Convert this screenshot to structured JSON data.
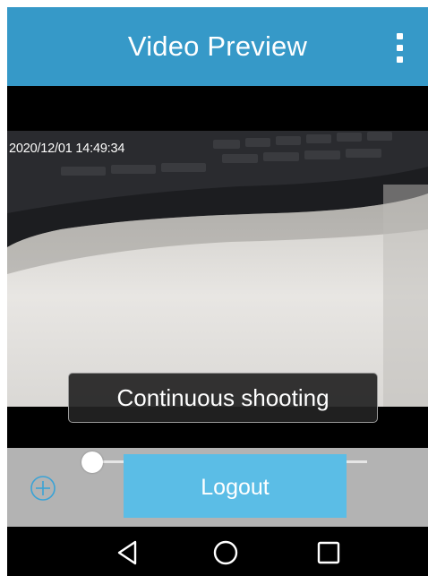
{
  "header": {
    "title": "Video Preview",
    "menu_icon": "more-vertical-icon"
  },
  "video": {
    "timestamp": "2020/12/01 14:49:34",
    "toast": "Continuous shooting"
  },
  "controls": {
    "zoom_icon": "zoom-in-icon",
    "zoom_level": 0.0,
    "logout_label": "Logout"
  },
  "navbar": {
    "icons": [
      "back-icon",
      "home-icon",
      "recents-icon"
    ]
  },
  "colors": {
    "header_bg": "#3699c8",
    "accent": "#5bbde6",
    "controls_bg": "#b3b3b3"
  }
}
